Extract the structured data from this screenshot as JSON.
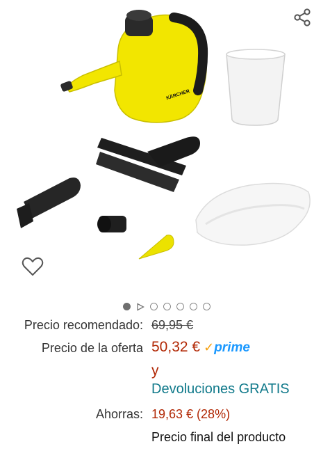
{
  "icons": {
    "share": "share-icon",
    "wishlist": "heart-outline-icon",
    "carousel_play": "play-triangle-icon"
  },
  "product_image": {
    "brand_mark": "KÄRCHER"
  },
  "carousel": {
    "total_dots": 7,
    "active_index": 0
  },
  "pricing": {
    "recommended_label": "Precio recomendado:",
    "recommended_value": "69,95 €",
    "offer_label": "Precio de la oferta",
    "offer_value": "50,32 €",
    "prime_check": "✓",
    "prime_label": "prime",
    "and_label": "y",
    "returns_label": "Devoluciones GRATIS",
    "savings_label": "Ahorras:",
    "savings_value": "19,63 € (28%)",
    "final_note": "Precio final del producto"
  },
  "colors": {
    "price_red": "#b12704",
    "returns_teal": "#117a8b",
    "prime_blue": "#1a98ff",
    "prime_check": "#f59e0b",
    "product_yellow": "#f2e600"
  }
}
